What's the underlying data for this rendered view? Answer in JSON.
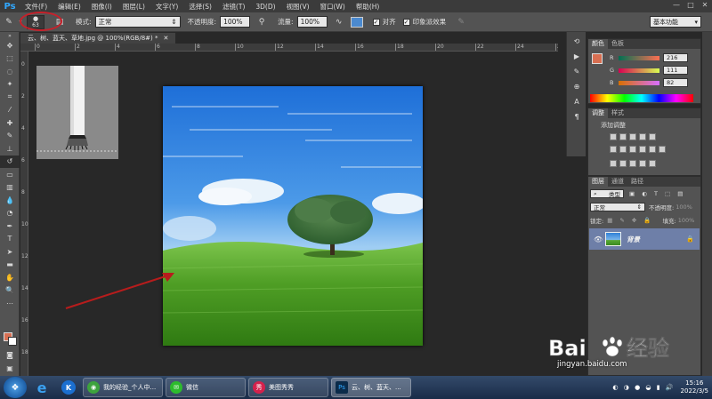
{
  "app": {
    "logo": "Ps"
  },
  "menu": [
    "文件(F)",
    "编辑(E)",
    "图像(I)",
    "图层(L)",
    "文字(Y)",
    "选择(S)",
    "滤镜(T)",
    "3D(D)",
    "视图(V)",
    "窗口(W)",
    "帮助(H)"
  ],
  "window_controls": [
    "—",
    "□",
    "✕"
  ],
  "options": {
    "brush_size": "63",
    "mode_label": "模式:",
    "mode_value": "正常",
    "opacity_label": "不透明度:",
    "opacity_value": "100%",
    "flow_label": "流量:",
    "flow_value": "100%",
    "align_label": "对齐",
    "sample_label": "印象派效果",
    "workspace": "基本功能"
  },
  "document": {
    "tab_title": "云、树、蓝天、草地.jpg @ 100%(RGB/8#) *",
    "ruler_h": [
      "0",
      "2",
      "4",
      "6",
      "8",
      "10",
      "12",
      "14",
      "16",
      "18",
      "20",
      "22",
      "24",
      "26"
    ],
    "ruler_v": [
      "0",
      "2",
      "4",
      "6",
      "8",
      "10",
      "12",
      "14",
      "16",
      "18"
    ]
  },
  "color_panel": {
    "tabs": [
      "颜色",
      "色板"
    ],
    "r_label": "R",
    "r_value": "216",
    "g_label": "G",
    "g_value": "111",
    "b_label": "B",
    "b_value": "82",
    "fg_color": "#d86f52"
  },
  "adjust_panel": {
    "tabs": [
      "调整",
      "样式"
    ],
    "title": "添加调整"
  },
  "layers_panel": {
    "tabs": [
      "图层",
      "通道",
      "路径"
    ],
    "filter": "类型",
    "blend": "正常",
    "opacity_label": "不透明度:",
    "opacity_value": "100%",
    "lock_label": "锁定:",
    "fill_label": "填充:",
    "fill_value": "100%",
    "layer_name": "背景"
  },
  "taskbar": {
    "tasks": [
      "我的经验_个人中...",
      "微信",
      "美图秀秀",
      "云、树、蓝天、..."
    ],
    "time": "15:16",
    "date": "2022/3/5"
  },
  "watermark": {
    "text": "jingyan.baidu.com"
  }
}
